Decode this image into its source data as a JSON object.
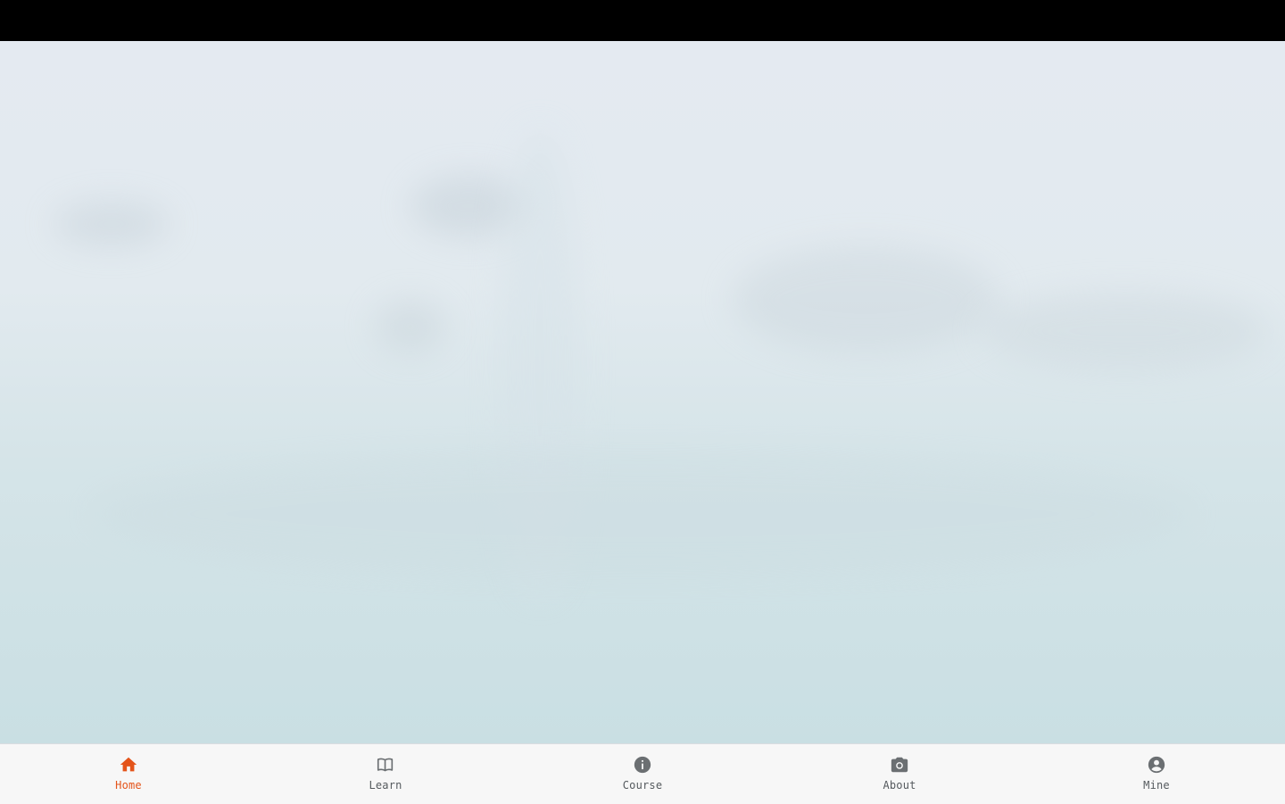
{
  "theme": {
    "active_color": "#e4541a",
    "inactive_color": "#6b6f72",
    "tab_bar_background": "#f7f7f7",
    "status_bar_background": "#000000"
  },
  "tabs": [
    {
      "label": "Home",
      "icon": "home-icon",
      "active": true
    },
    {
      "label": "Learn",
      "icon": "book-icon",
      "active": false
    },
    {
      "label": "Course",
      "icon": "info-icon",
      "active": false
    },
    {
      "label": "About",
      "icon": "camera-icon",
      "active": false
    },
    {
      "label": "Mine",
      "icon": "account-circle-icon",
      "active": false
    }
  ]
}
